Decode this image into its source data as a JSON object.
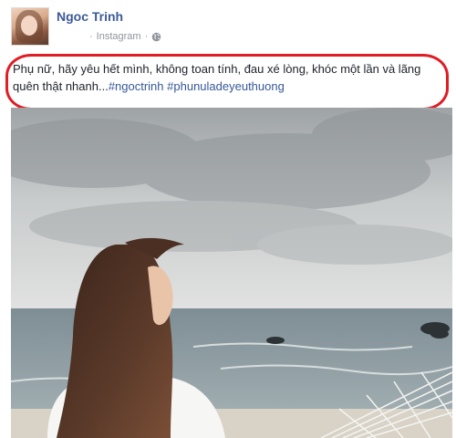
{
  "post": {
    "author": "Ngoc Trinh",
    "source": "Instagram",
    "separator": "·",
    "status_text": "Phụ nữ, hãy yêu hết mình, không toan tính, đau xé lòng, khóc một lần và lãng quên thật nhanh...",
    "hashtags": [
      "#ngoctrinh",
      "#phunuladeyeuthuong"
    ],
    "colors": {
      "name": "#3b5998",
      "hashtag": "#365899",
      "highlight": "#e01c24",
      "meta": "#90949c"
    }
  }
}
